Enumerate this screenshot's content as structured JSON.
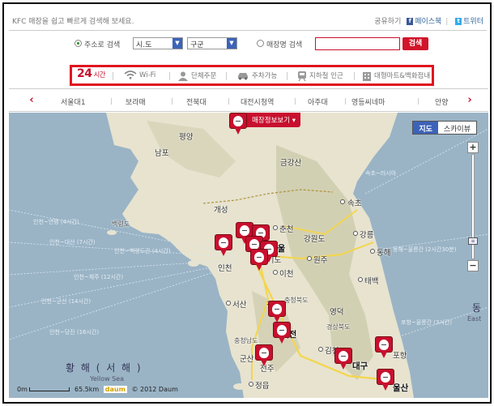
{
  "intro": "KFC 매장을 쉽고 빠르게 검색해 보세요.",
  "share": {
    "label": "공유하기",
    "facebook": "페이스북",
    "twitter": "트위터",
    "separator": "|"
  },
  "search": {
    "by_address_label": "주소로 검색",
    "city_value": "시.도",
    "district_value": "구군",
    "by_store_label": "매장명 검색",
    "store_input_value": "",
    "button": "검색"
  },
  "filters": {
    "hours_number": "24",
    "hours_label": "시간",
    "wifi": "Wi-Fi",
    "group_order": "단체주문",
    "parking": "주차가능",
    "subway": "지하철 인근",
    "mart": "대형마트&백화점내"
  },
  "subway": {
    "prev": "‹",
    "next": "›",
    "stations": [
      "서울대1",
      "보라매",
      "전북대",
      "대전시청역",
      "아주대",
      "영등씨네마",
      "안양"
    ]
  },
  "map": {
    "store_info_button": "매장정보보기",
    "map_type": [
      "지도",
      "스카이뷰"
    ],
    "zoom_in": "+",
    "zoom_out": "−",
    "sea_name": "황 해 ( 서 해 )",
    "sea_name_en": "Yellow Sea",
    "east_sea_ko": "동",
    "east_sea_en": "East",
    "scale_zero": "0m",
    "scale_value": "65.5km",
    "logo": "daum",
    "copyright": "© 2012 Daum",
    "places": {
      "pyongyang": "평양",
      "nampo": "남포",
      "geumgangsan": "금강산",
      "gaeseong": "개성",
      "baengnyeong": "백령도",
      "sokcho": "속초",
      "chuncheon": "춘천",
      "gangwon": "강원도",
      "gangneung": "강릉",
      "donghae": "동해",
      "wonju": "원주",
      "incheon": "인천",
      "seoul": "서울",
      "gyeonggi": "경기도",
      "icheon": "이천",
      "taebaek": "태백",
      "chungbuk": "충청북도",
      "seosan": "서산",
      "cheonan": "천안",
      "chungnam": "충청남도",
      "daejeon": "대전",
      "yeongdeok": "영덕",
      "gyeongbuk": "경상북도",
      "gimcheon": "김천",
      "daegu": "대구",
      "pohang": "포항",
      "gunsan": "군산",
      "jeonju": "전주",
      "jeongeup": "정읍",
      "ulsan": "울산"
    },
    "routes": {
      "incheon_baengnyeong": "인천~백령도간 (4시간)",
      "incheon_jeju": "인천~제주 (13시간)",
      "incheon_16": "인천~당진 (16시간)",
      "incheon_14": "인천~군산 (14시간)",
      "incheon_7": "인천~대산 (7시간)",
      "incheon_12": "인천~제주 (12시간)",
      "mukho_ulleung": "동해~울릉간 (2시간30분)",
      "pohang_ulleung": "포항~울릉간 (3시간)",
      "sokcho_route": "속초~러시아",
      "incheon_yeonpyeong": "인천~연평 (4시간)"
    }
  }
}
